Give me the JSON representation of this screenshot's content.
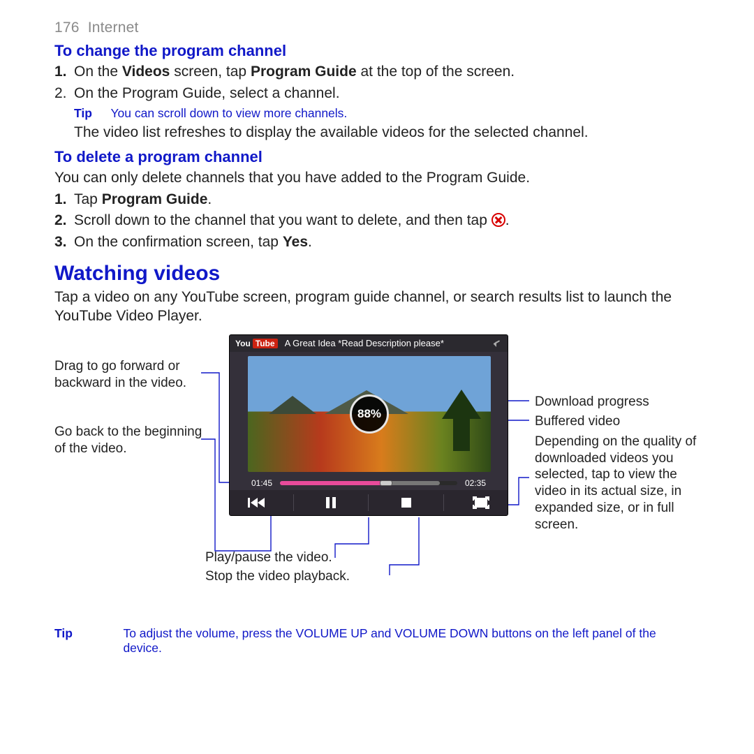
{
  "pageHeader": {
    "number": "176",
    "section": "Internet"
  },
  "sec1": {
    "heading": "To change the program channel",
    "step1_pre": "On the ",
    "step1_b1": "Videos",
    "step1_mid": " screen, tap ",
    "step1_b2": "Program Guide",
    "step1_post": " at the top of the screen.",
    "step2": "On the Program Guide, select a channel.",
    "tipLabel": "Tip",
    "tipText": "You can scroll down to view more channels.",
    "tail": "The video list refreshes to display the available videos for the selected channel."
  },
  "sec2": {
    "heading": "To delete a program channel",
    "intro": "You can only delete channels that you have added to the Program Guide.",
    "step1_pre": "Tap ",
    "step1_bold": "Program Guide",
    "step1_post": ".",
    "step2_pre": "Scroll down to the channel that you want to delete, and then tap ",
    "step2_post": ".",
    "step3_pre": "On the confirmation screen, tap ",
    "step3_bold": "Yes",
    "step3_post": "."
  },
  "sec3": {
    "heading": "Watching videos",
    "intro": "Tap a video on any YouTube screen, program guide channel, or search results list to launch the YouTube Video Player."
  },
  "player": {
    "logo": {
      "you": "You",
      "tube": "Tube"
    },
    "title": "A Great Idea *Read Description please*",
    "percent": "88%",
    "elapsed": "01:45",
    "total": "02:35"
  },
  "callouts": {
    "drag": "Drag to go forward or backward in the video.",
    "goback": "Go back to the beginning of the video.",
    "playpause": "Play/pause the video.",
    "stop": "Stop the video playback.",
    "download": "Download progress",
    "buffered": "Buffered video",
    "zoom": "Depending on the quality of downloaded videos you selected, tap to view the video in its actual size, in expanded size, or in full screen."
  },
  "tip2": {
    "label": "Tip",
    "text": "To adjust the volume, press the VOLUME UP and VOLUME DOWN buttons on the left panel of the device."
  }
}
